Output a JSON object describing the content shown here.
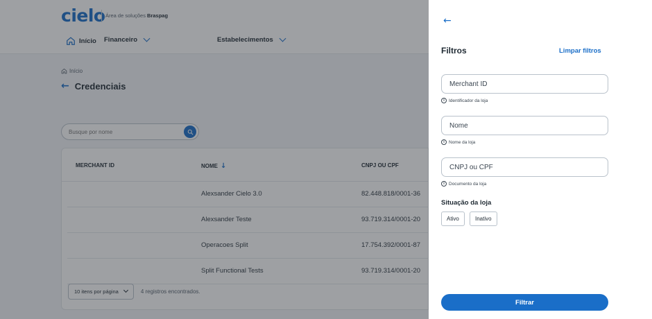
{
  "header": {
    "logo": "cielo",
    "subtitle_prefix": "Área de soluções",
    "subtitle_brand": "Braspag",
    "nav": {
      "home": "Início",
      "financeiro": "Financeiro",
      "estabelecimentos": "Estabelecimentos"
    }
  },
  "breadcrumb": "Início",
  "page_title": "Credenciais",
  "search": {
    "placeholder": "Busque por nome"
  },
  "table": {
    "columns": {
      "merchant_id": "MERCHANT ID",
      "nome": "NOME",
      "doc": "CNPJ OU CPF"
    },
    "rows": [
      {
        "merchant_id": "",
        "nome": "Alexsander Cielo 3.0",
        "doc": "82.448.818/0001-36"
      },
      {
        "merchant_id": "",
        "nome": "Alexsander Teste",
        "doc": "93.719.314/0001-20"
      },
      {
        "merchant_id": "",
        "nome": "Operacoes Split",
        "doc": "17.754.392/0001-87"
      },
      {
        "merchant_id": "",
        "nome": "Split Functional Tests",
        "doc": "93.719.314/0001-20"
      }
    ],
    "per_page": "10 itens por página",
    "records": "4 registros encontrados."
  },
  "drawer": {
    "title": "Filtros",
    "clear": "Limpar filtros",
    "fields": [
      {
        "placeholder": "Merchant ID",
        "value": "",
        "hint": "Identificador da loja"
      },
      {
        "placeholder": "Nome",
        "value": "",
        "hint": "Nome da loja"
      },
      {
        "placeholder": "CNPJ ou CPF",
        "value": "",
        "hint": "Documento da loja"
      }
    ],
    "status_label": "Situação da loja",
    "status_options": [
      "Ativo",
      "Inativo"
    ],
    "submit": "Filtrar"
  },
  "colors": {
    "accent": "#1a6ec8",
    "overlay": "rgba(40,44,50,0.45)"
  }
}
